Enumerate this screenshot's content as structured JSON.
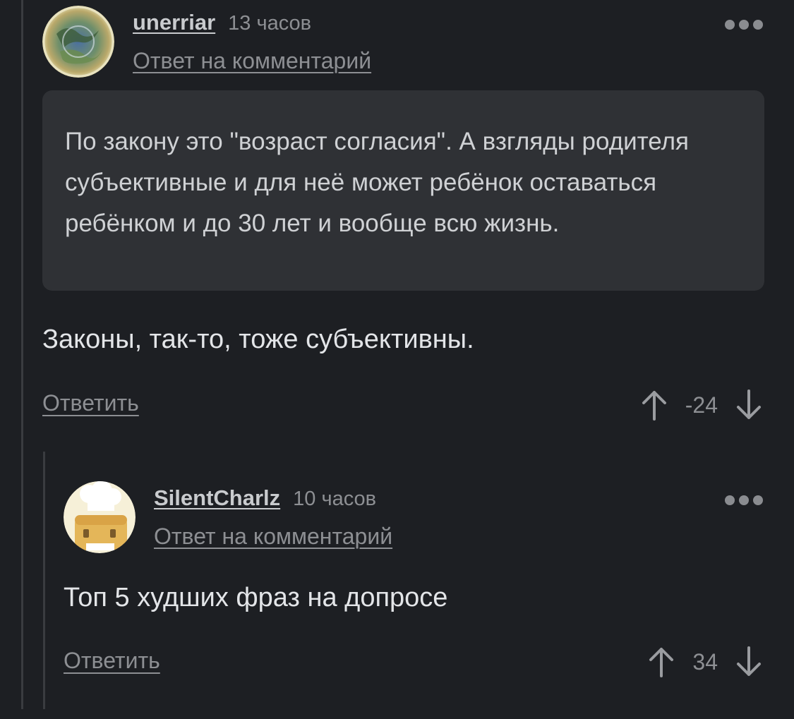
{
  "comments": [
    {
      "username": "unerriar",
      "time": "13 часов",
      "reply_to": "Ответ на комментарий",
      "quote": "По закону это \"возраст согласия\". А взгляды родителя субъективные и для неё может ребёнок оставаться ребёнком и до 30 лет и вообще всю жизнь.",
      "text": "Законы, так-то, тоже субъективны.",
      "reply_label": "Ответить",
      "score": "-24",
      "avatar_icon": "globe-avatar-icon"
    },
    {
      "username": "SilentCharlz",
      "time": "10 часов",
      "reply_to": "Ответ на комментарий",
      "text": "Топ 5 худших фраз на допросе",
      "reply_label": "Ответить",
      "score": "34",
      "avatar_icon": "chef-toast-avatar-icon"
    }
  ],
  "icons": {
    "more": "more-dots-icon",
    "upvote": "arrow-up-icon",
    "downvote": "arrow-down-icon"
  },
  "colors": {
    "background": "#1d1f23",
    "quote_background": "#2f3135",
    "muted_text": "#8d8f93"
  }
}
